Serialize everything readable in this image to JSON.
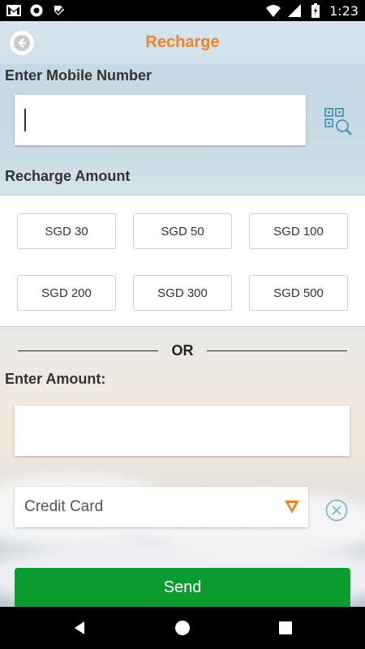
{
  "status_bar": {
    "time": "1:23",
    "left_icons": [
      "gmail-icon",
      "circle-app-icon",
      "verified-check-icon"
    ],
    "right_icons": [
      "wifi-icon",
      "signal-icon",
      "battery-icon"
    ]
  },
  "header": {
    "title": "Recharge",
    "back_icon": "back-arrow-icon",
    "title_color": "#ef8428"
  },
  "mobile": {
    "label": "Enter Mobile Number",
    "value": "",
    "scan_icon": "qr-search-icon"
  },
  "recharge": {
    "label": "Recharge Amount",
    "options": [
      "SGD 30",
      "SGD 50",
      "SGD 100",
      "SGD 200",
      "SGD 300",
      "SGD 500"
    ]
  },
  "divider": {
    "text": "OR"
  },
  "custom_amount": {
    "label": "Enter Amount:",
    "value": ""
  },
  "payment": {
    "selected": "Credit Card",
    "dropdown_color": "#ef8428",
    "clear_icon": "close-circle-icon"
  },
  "send": {
    "label": "Send",
    "color": "#0c9b2f"
  },
  "nav": [
    "back-nav-icon",
    "home-nav-icon",
    "recents-nav-icon"
  ]
}
